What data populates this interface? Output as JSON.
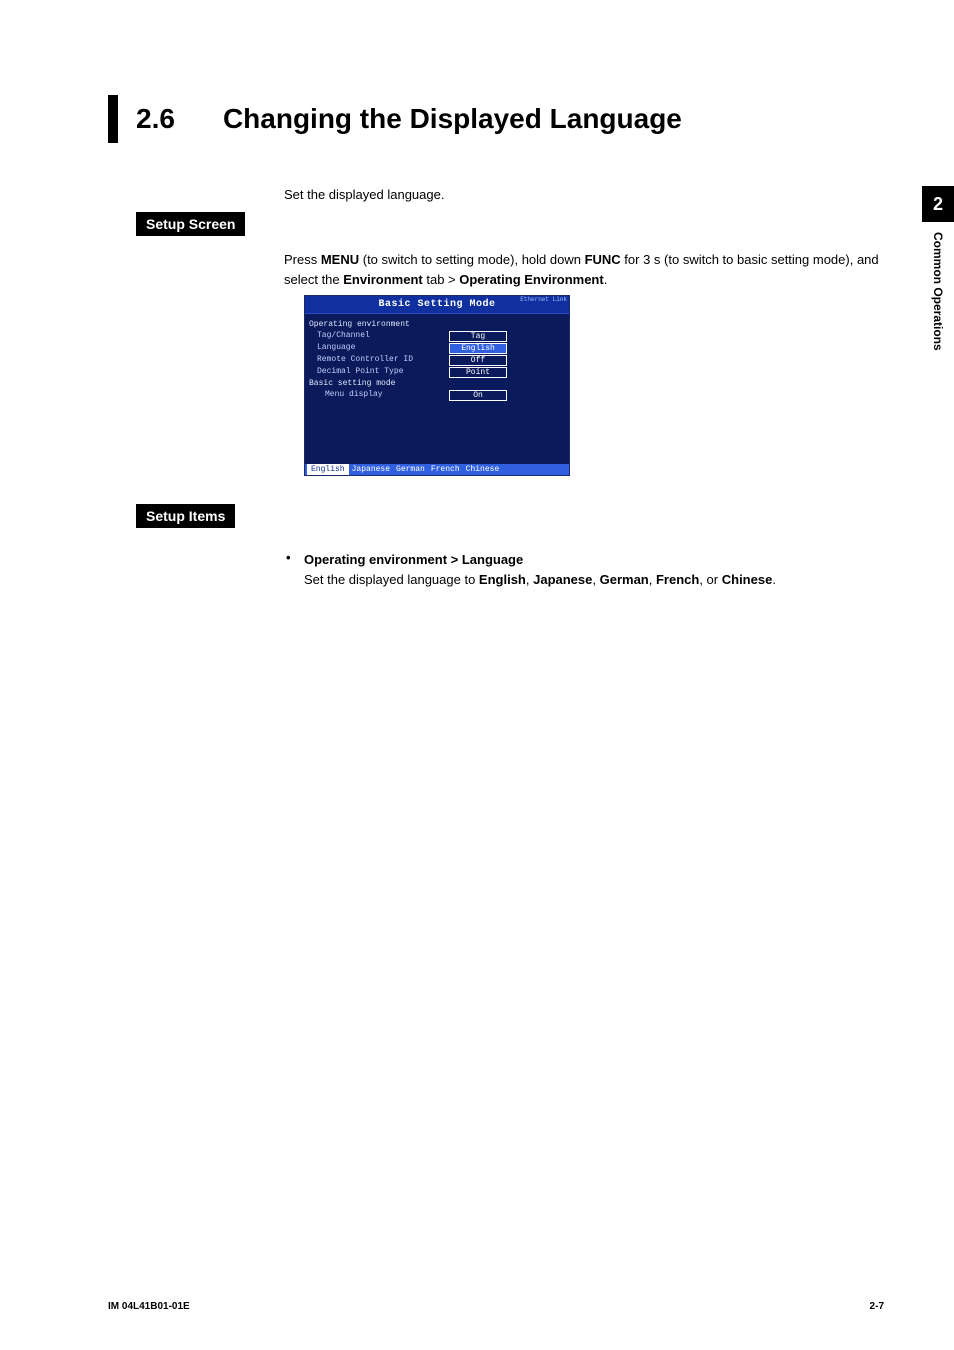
{
  "heading": {
    "number": "2.6",
    "title": "Changing the Displayed Language"
  },
  "intro": "Set the displayed language.",
  "badges": {
    "setup_screen": "Setup Screen",
    "setup_items": "Setup Items"
  },
  "steps": {
    "pre_menu": "Press ",
    "menu": "MENU",
    "after_menu": " (to switch to setting mode), hold down ",
    "func": "FUNC",
    "after_func": " for 3 s (to switch to basic setting mode), and select the ",
    "env_tab": "Environment",
    "after_env": " tab > ",
    "op_env": "Operating Environment",
    "period": "."
  },
  "screenshot": {
    "title": "Basic Setting Mode",
    "link": "Ethernet\nLink",
    "section": "Operating environment",
    "rows": [
      {
        "label": "Tag/Channel",
        "value": "Tag",
        "selected": false
      },
      {
        "label": "Language",
        "value": "English",
        "selected": true
      },
      {
        "label": "Remote Controller ID",
        "value": "Off",
        "selected": false
      },
      {
        "label": "Decimal Point Type",
        "value": "Point",
        "selected": false
      }
    ],
    "subsection": "Basic setting mode",
    "subrows": [
      {
        "label": "Menu display",
        "value": "On",
        "selected": false
      }
    ],
    "options": [
      "English",
      "Japanese",
      "German",
      "French",
      "Chinese"
    ],
    "selected_option_index": 0
  },
  "setup_items": {
    "heading": "Operating environment > Language",
    "line_pre": "Set the displayed language to ",
    "langs": [
      "English",
      "Japanese",
      "German",
      "French",
      "Chinese"
    ],
    "joiner": ", ",
    "or": ", or ",
    "period": "."
  },
  "side_tab": {
    "number": "2",
    "label": "Common Operations"
  },
  "footer": {
    "left": "IM 04L41B01-01E",
    "right": "2-7"
  }
}
